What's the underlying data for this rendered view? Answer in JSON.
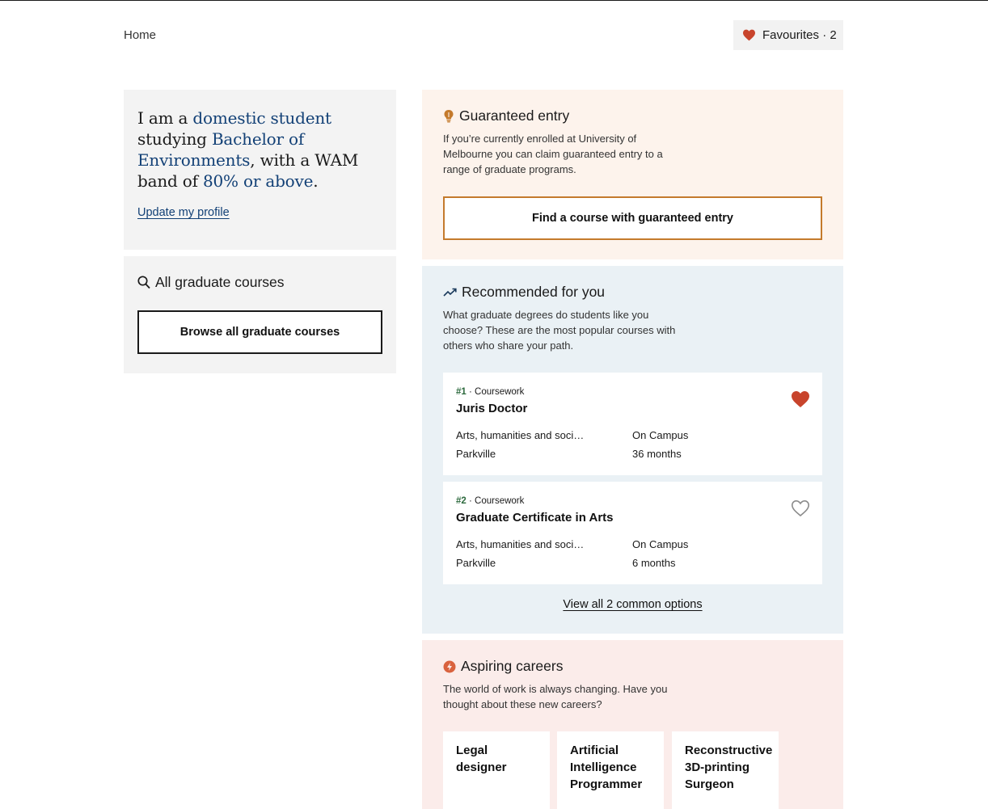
{
  "nav": {
    "home_label": "Home",
    "favourites_label": "Favourites · 2"
  },
  "profile": {
    "intro": "I am a",
    "student_type": "domestic student",
    "studying_label": "studying",
    "degree": "Bachelor of Environments",
    "wam_label": ", with a WAM band of",
    "wam_band": "80% or above",
    "period": ".",
    "update_link": "Update my profile"
  },
  "browse": {
    "heading": "All graduate courses",
    "button_label": "Browse all graduate courses",
    "icon": "search-icon"
  },
  "guaranteed": {
    "heading": "Guaranteed entry",
    "description": "If you’re currently enrolled at University of Melbourne you can claim guaranteed entry to a range of graduate programs.",
    "button_label": "Find a course with guaranteed entry",
    "icon": "lightbulb-icon",
    "accent": "#c47a2c"
  },
  "recommended": {
    "heading": "Recommended for you",
    "description": "What graduate degrees do students like you choose? These are the most popular courses with others who share your path.",
    "icon": "trending-up-icon",
    "courses": [
      {
        "rank": "#1",
        "type": " · Coursework",
        "title": "Juris Doctor",
        "area": "Arts, humanities and social sciences",
        "campus": "Parkville",
        "mode": "On Campus",
        "duration": "36 months",
        "favourited": true
      },
      {
        "rank": "#2",
        "type": " · Coursework",
        "title": "Graduate Certificate in Arts",
        "area": "Arts, humanities and social sciences",
        "campus": "Parkville",
        "mode": "On Campus",
        "duration": "6 months",
        "favourited": false
      }
    ],
    "view_all_label": "View all 2 common options"
  },
  "careers": {
    "heading": "Aspiring careers",
    "description": "The world of work is always changing. Have you thought about these new careers?",
    "icon": "bolt-circle-icon",
    "items": [
      "Legal designer",
      "Artificial Intelligence Programmer",
      "Reconstructive 3D-printing Surgeon"
    ]
  },
  "colors": {
    "heart": "#c8442c",
    "link": "#124076",
    "rank": "#2d6a3e"
  }
}
